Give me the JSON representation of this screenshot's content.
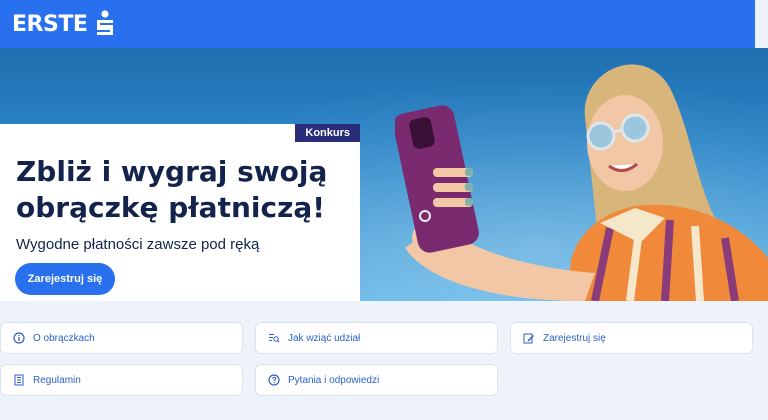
{
  "brand": {
    "name": "ERSTE",
    "accent": "#2870ed"
  },
  "hero": {
    "badge": "Konkurs",
    "headline": "Zbliż i wygraj swoją obrączkę płatniczą!",
    "subline": "Wygodne płatności zawsze pod ręką",
    "cta": "Zarejestruj się"
  },
  "links": [
    {
      "label": "O obrączkach",
      "icon": "info-icon"
    },
    {
      "label": "Jak wziąć udział",
      "icon": "search-list-icon"
    },
    {
      "label": "Zarejestruj się",
      "icon": "edit-icon"
    },
    {
      "label": "Regulamin",
      "icon": "document-icon"
    },
    {
      "label": "Pytania i odpowiedzi",
      "icon": "question-icon"
    }
  ]
}
